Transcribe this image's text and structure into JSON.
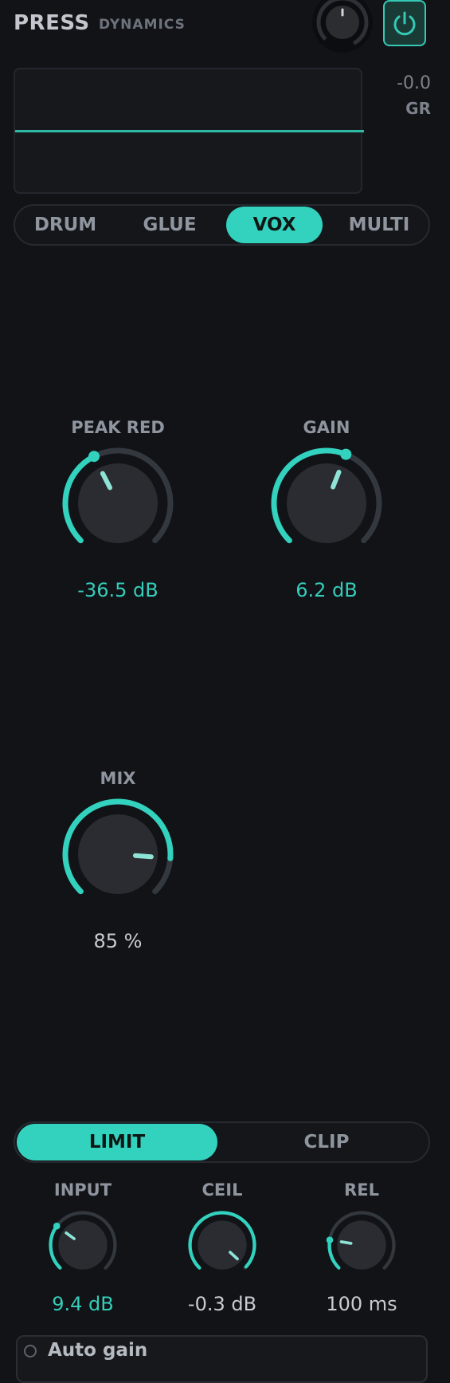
{
  "header": {
    "title": "PRESS",
    "subtitle": "DYNAMICS"
  },
  "meter": {
    "gr_value": "-0.0",
    "gr_label": "GR"
  },
  "modes": {
    "items": [
      "DRUM",
      "GLUE",
      "VOX",
      "MULTI"
    ],
    "active": "VOX"
  },
  "knobs": {
    "peak_red": {
      "label": "PEAK RED",
      "value": "-36.5 dB",
      "level": 0.4
    },
    "gain": {
      "label": "GAIN",
      "value": "6.2 dB",
      "level": 0.58
    },
    "mix": {
      "label": "MIX",
      "value": "85 %",
      "level": 0.85
    }
  },
  "limiter": {
    "tabs": [
      "LIMIT",
      "CLIP"
    ],
    "active": "LIMIT",
    "input": {
      "label": "INPUT",
      "value": "9.4 dB",
      "level": 0.3
    },
    "ceil": {
      "label": "CEIL",
      "value": "-0.3 dB",
      "level": 0.99
    },
    "rel": {
      "label": "REL",
      "value": "100 ms",
      "level": 0.2
    }
  },
  "auto_gain": {
    "label": "Auto gain"
  },
  "colors": {
    "accent": "#32d2bf",
    "background": "#111317",
    "muted": "#8f959e"
  }
}
